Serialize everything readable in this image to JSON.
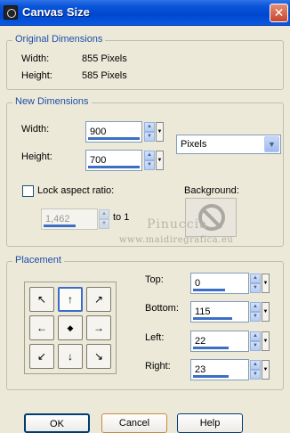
{
  "window": {
    "title": "Canvas Size",
    "close_glyph": "✕"
  },
  "original": {
    "group_label": "Original Dimensions",
    "width_label": "Width:",
    "width_value": "855 Pixels",
    "height_label": "Height:",
    "height_value": "585 Pixels"
  },
  "new_dims": {
    "group_label": "New Dimensions",
    "width_label": "Width:",
    "width_value": "900",
    "height_label": "Height:",
    "height_value": "700",
    "units": "Pixels",
    "lock_label": "Lock aspect ratio:",
    "ratio_value": "1,462",
    "to_label": "to 1",
    "background_label": "Background:"
  },
  "watermark": {
    "name": "Pinuccia",
    "url": "www.maidiregrafica.eu"
  },
  "placement": {
    "group_label": "Placement",
    "top_label": "Top:",
    "top_value": "0",
    "bottom_label": "Bottom:",
    "bottom_value": "115",
    "left_label": "Left:",
    "left_value": "22",
    "right_label": "Right:",
    "right_value": "23",
    "anchors": [
      "↖",
      "↑",
      "↗",
      "←",
      "◆",
      "→",
      "↙",
      "↓",
      "↘"
    ]
  },
  "buttons": {
    "ok": "OK",
    "cancel": "Cancel",
    "help": "Help"
  }
}
